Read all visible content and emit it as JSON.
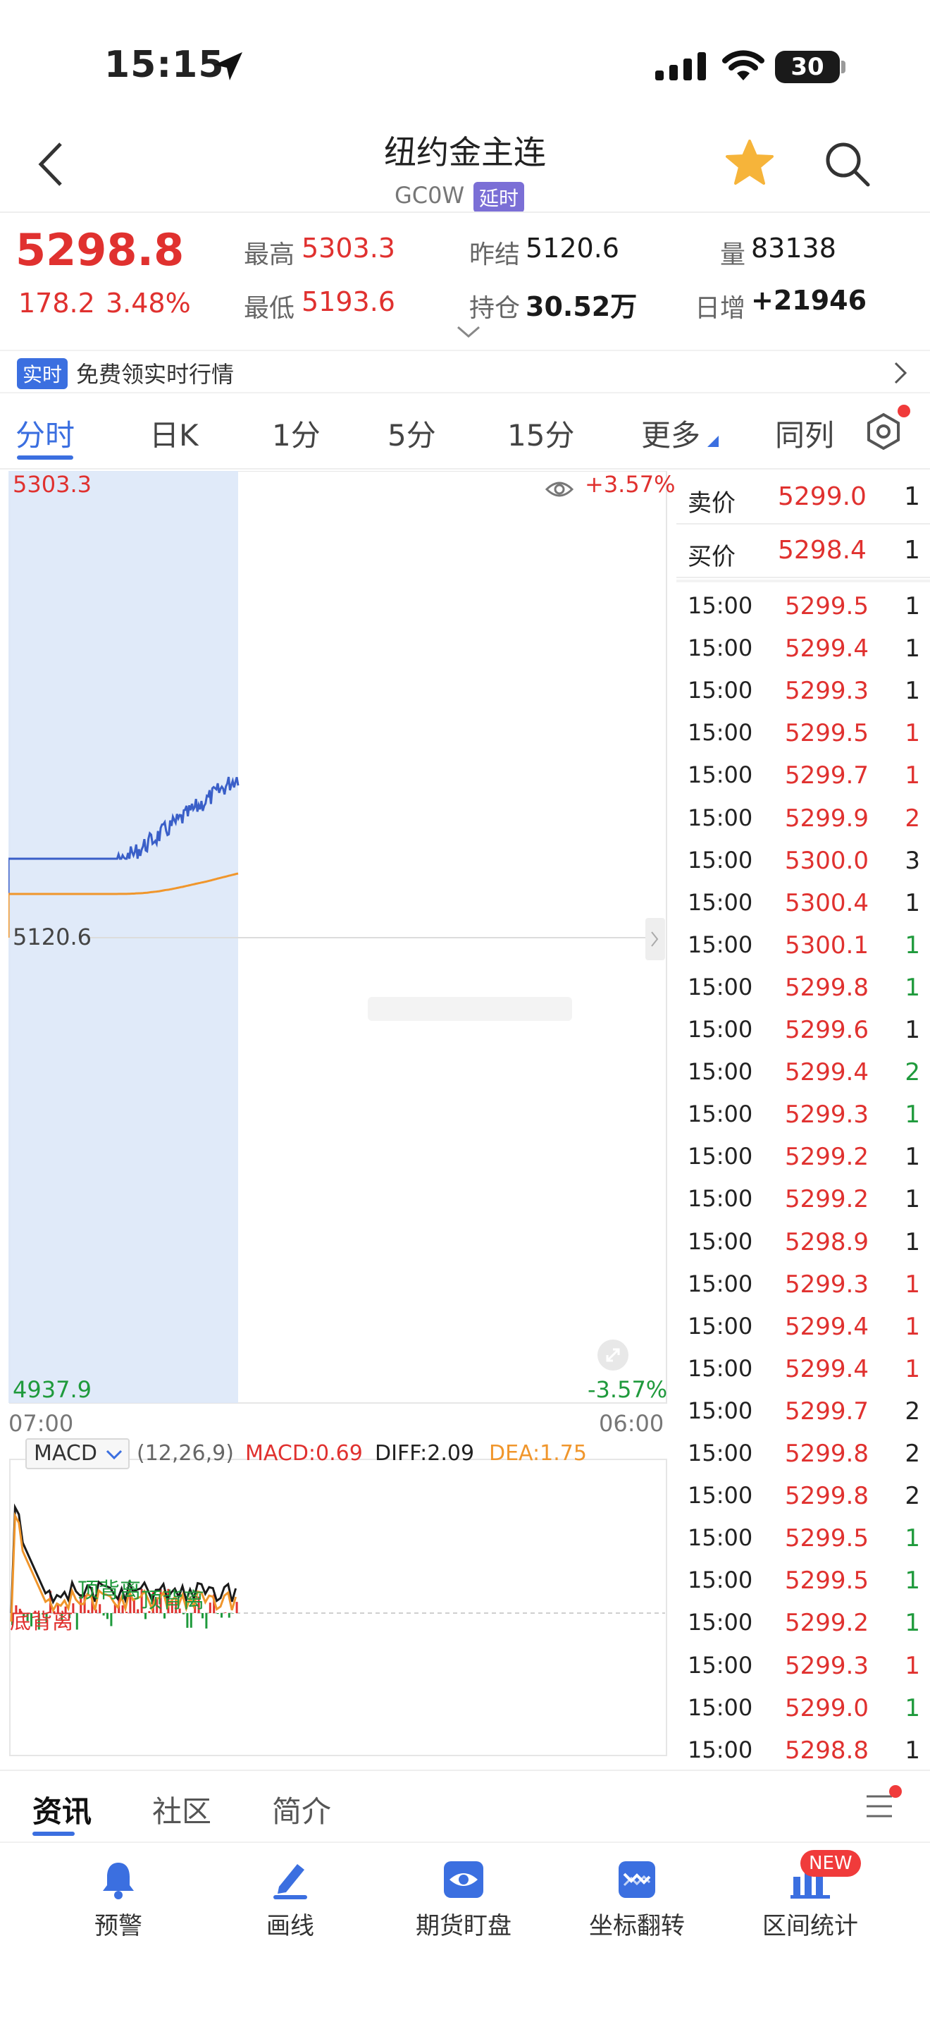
{
  "status_bar": {
    "time": "15:15",
    "battery": "30"
  },
  "header": {
    "title": "纽约金主连",
    "code": "GC0W",
    "delay_badge": "延时"
  },
  "quote": {
    "last_price": "5298.8",
    "change": "178.2",
    "change_pct": "3.48%",
    "high_label": "最高",
    "high": "5303.3",
    "low_label": "最低",
    "low": "5193.6",
    "prev_settle_label": "昨结",
    "prev_settle": "5120.6",
    "open_interest_label": "持仓",
    "open_interest": "30.52万",
    "volume_label": "量",
    "volume": "83138",
    "daily_increase_label": "日增",
    "daily_increase": "+21946"
  },
  "notice": {
    "badge": "实时",
    "text": "免费领实时行情"
  },
  "tabs": [
    "分时",
    "日K",
    "1分",
    "5分",
    "15分",
    "更多",
    "同列"
  ],
  "chart": {
    "top_price": "5303.3",
    "top_pct": "+3.57%",
    "mid_price": "5120.6",
    "bottom_price": "4937.9",
    "bottom_pct": "-3.57%",
    "time_start": "07:00",
    "time_end": "06:00",
    "indicator": {
      "name": "MACD",
      "params": "(12,26,9)",
      "macd_label": "MACD:",
      "macd_value": "0.69",
      "diff_label": "DIFF:",
      "diff_value": "2.09",
      "dea_label": "DEA:",
      "dea_value": "1.75",
      "annotations": [
        "顶背离",
        "顶背离",
        "底背离"
      ]
    }
  },
  "colors": {
    "up": "#e0312f",
    "down": "#1f9a3c",
    "accent": "#3b6fe0",
    "avg_line": "#f0962c"
  },
  "order_book": {
    "ask_label": "卖价",
    "ask_price": "5299.0",
    "ask_vol": "1",
    "bid_label": "买价",
    "bid_price": "5298.4",
    "bid_vol": "1"
  },
  "trades": [
    {
      "time": "15:00",
      "price": "5299.5",
      "vol": "1",
      "dir": "dark"
    },
    {
      "time": "15:00",
      "price": "5299.4",
      "vol": "1",
      "dir": "dark"
    },
    {
      "time": "15:00",
      "price": "5299.3",
      "vol": "1",
      "dir": "dark"
    },
    {
      "time": "15:00",
      "price": "5299.5",
      "vol": "1",
      "dir": "red"
    },
    {
      "time": "15:00",
      "price": "5299.7",
      "vol": "1",
      "dir": "red"
    },
    {
      "time": "15:00",
      "price": "5299.9",
      "vol": "2",
      "dir": "red"
    },
    {
      "time": "15:00",
      "price": "5300.0",
      "vol": "3",
      "dir": "dark"
    },
    {
      "time": "15:00",
      "price": "5300.4",
      "vol": "1",
      "dir": "dark"
    },
    {
      "time": "15:00",
      "price": "5300.1",
      "vol": "1",
      "dir": "green"
    },
    {
      "time": "15:00",
      "price": "5299.8",
      "vol": "1",
      "dir": "green"
    },
    {
      "time": "15:00",
      "price": "5299.6",
      "vol": "1",
      "dir": "dark"
    },
    {
      "time": "15:00",
      "price": "5299.4",
      "vol": "2",
      "dir": "green"
    },
    {
      "time": "15:00",
      "price": "5299.3",
      "vol": "1",
      "dir": "green"
    },
    {
      "time": "15:00",
      "price": "5299.2",
      "vol": "1",
      "dir": "dark"
    },
    {
      "time": "15:00",
      "price": "5299.2",
      "vol": "1",
      "dir": "dark"
    },
    {
      "time": "15:00",
      "price": "5298.9",
      "vol": "1",
      "dir": "dark"
    },
    {
      "time": "15:00",
      "price": "5299.3",
      "vol": "1",
      "dir": "red"
    },
    {
      "time": "15:00",
      "price": "5299.4",
      "vol": "1",
      "dir": "red"
    },
    {
      "time": "15:00",
      "price": "5299.4",
      "vol": "1",
      "dir": "red"
    },
    {
      "time": "15:00",
      "price": "5299.7",
      "vol": "2",
      "dir": "dark"
    },
    {
      "time": "15:00",
      "price": "5299.8",
      "vol": "2",
      "dir": "dark"
    },
    {
      "time": "15:00",
      "price": "5299.8",
      "vol": "2",
      "dir": "dark"
    },
    {
      "time": "15:00",
      "price": "5299.5",
      "vol": "1",
      "dir": "green"
    },
    {
      "time": "15:00",
      "price": "5299.5",
      "vol": "1",
      "dir": "green"
    },
    {
      "time": "15:00",
      "price": "5299.2",
      "vol": "1",
      "dir": "green"
    },
    {
      "time": "15:00",
      "price": "5299.3",
      "vol": "1",
      "dir": "red"
    },
    {
      "time": "15:00",
      "price": "5299.0",
      "vol": "1",
      "dir": "green"
    },
    {
      "time": "15:00",
      "price": "5298.8",
      "vol": "1",
      "dir": "dark"
    }
  ],
  "bottom_tabs": [
    "资讯",
    "社区",
    "简介"
  ],
  "toolbar": [
    {
      "label": "预警",
      "icon": "bell-icon"
    },
    {
      "label": "画线",
      "icon": "pen-icon"
    },
    {
      "label": "期货盯盘",
      "icon": "eye-icon"
    },
    {
      "label": "坐标翻转",
      "icon": "flip-icon"
    },
    {
      "label": "区间统计",
      "icon": "stats-icon"
    }
  ],
  "new_badge": "NEW"
}
